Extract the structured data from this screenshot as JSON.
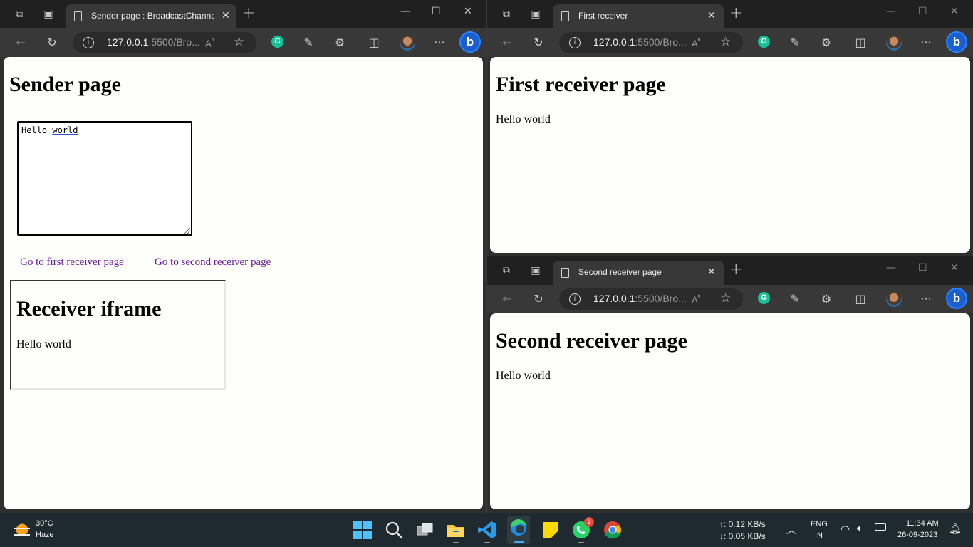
{
  "sender_window": {
    "tab_title": "Sender page : BroadcastChannel",
    "url_host": "127.0.0.1",
    "url_rest": ":5500/Bro...",
    "heading": "Sender page",
    "textarea_value_1": "Hello ",
    "textarea_value_2": "world",
    "link_first": "Go to first receiver page",
    "link_second": "Go to second receiver page",
    "iframe_heading": "Receiver iframe",
    "iframe_text": "Hello world"
  },
  "first_window": {
    "tab_title": "First receiver",
    "url_host": "127.0.0.1",
    "url_rest": ":5500/Bro...",
    "heading": "First receiver page",
    "text": "Hello world"
  },
  "second_window": {
    "tab_title": "Second receiver page",
    "url_host": "127.0.0.1",
    "url_rest": ":5500/Bro...",
    "heading": "Second receiver page",
    "text": "Hello world"
  },
  "taskbar": {
    "weather_temp": "30°C",
    "weather_desc": "Haze",
    "net_up": "↑: 0.12 KB/s",
    "net_down": "↓: 0.05 KB/s",
    "lang_1": "ENG",
    "lang_2": "IN",
    "time": "11:34 AM",
    "date": "26-09-2023",
    "whatsapp_badge": "2"
  },
  "colors": {
    "link_visited": "#6a1b9a",
    "grammarly": "#15c39a",
    "bing": "#1a5fd0",
    "taskbar_bg": "#1f2a30"
  },
  "icons": [
    "workspaces-icon",
    "tab-actions-icon",
    "page-icon",
    "close-icon",
    "new-tab-icon",
    "back-icon",
    "refresh-icon",
    "info-icon",
    "read-aloud-icon",
    "favorite-star-icon",
    "grammarly-icon",
    "eyedropper-icon",
    "extensions-icon",
    "split-screen-icon",
    "profile-avatar",
    "more-icon",
    "bing-icon",
    "weather-icon",
    "start-icon",
    "search-icon",
    "task-view-icon",
    "file-explorer-icon",
    "vscode-icon",
    "edge-icon",
    "sticky-notes-icon",
    "whatsapp-icon",
    "chrome-icon",
    "wifi-icon",
    "volume-icon",
    "battery-icon",
    "notification-icon"
  ]
}
